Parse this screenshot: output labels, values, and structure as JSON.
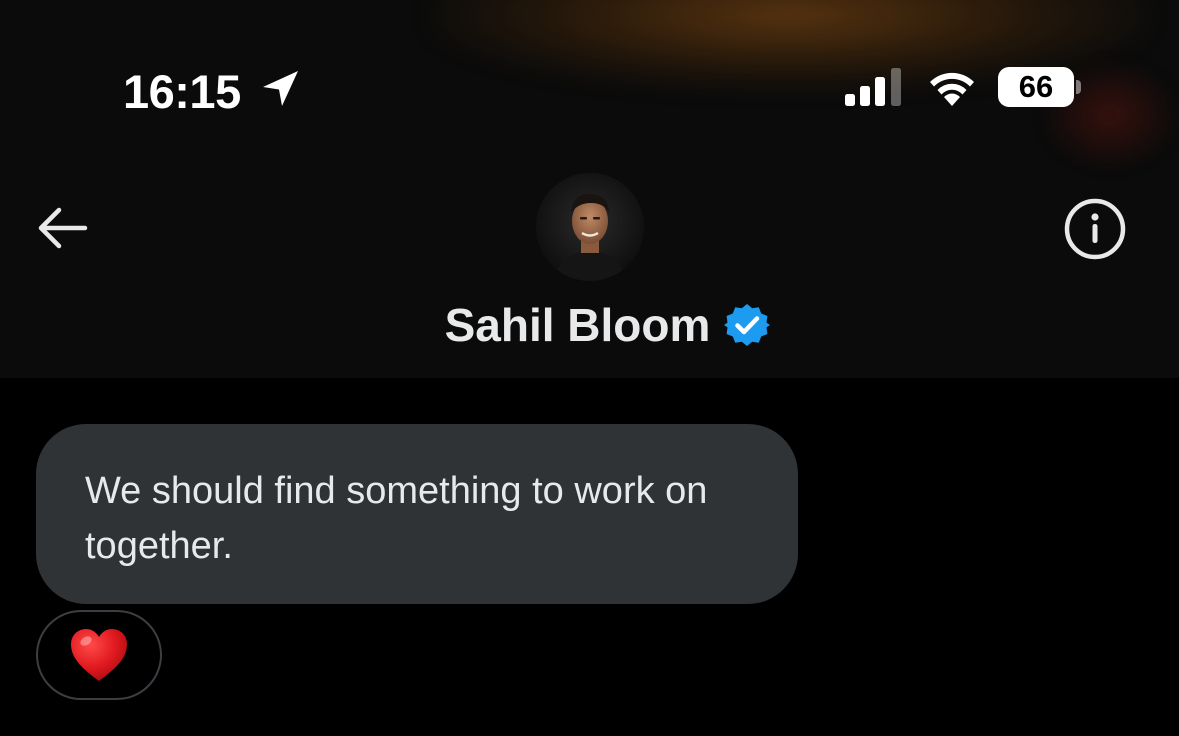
{
  "status_bar": {
    "time": "16:15",
    "battery_level": "66",
    "battery_fraction": 0.66,
    "icons": [
      "location-arrow-icon",
      "cellular-signal-icon",
      "wifi-icon",
      "battery-icon"
    ]
  },
  "header": {
    "back_icon": "arrow-left-icon",
    "info_icon": "info-circle-icon",
    "user_name": "Sahil Bloom",
    "verified_icon": "verified-badge-icon",
    "verified_color": "#1d9bf0"
  },
  "conversation": {
    "messages": [
      {
        "text": "We should find something to work on together.",
        "reaction": "❤️",
        "reaction_icon": "red-heart-icon"
      }
    ]
  },
  "colors": {
    "background": "#000000",
    "header_bg": "#0b0b0b",
    "bubble_bg": "#2f3336",
    "text": "#e7e9ea",
    "heart": "#e0191f"
  }
}
